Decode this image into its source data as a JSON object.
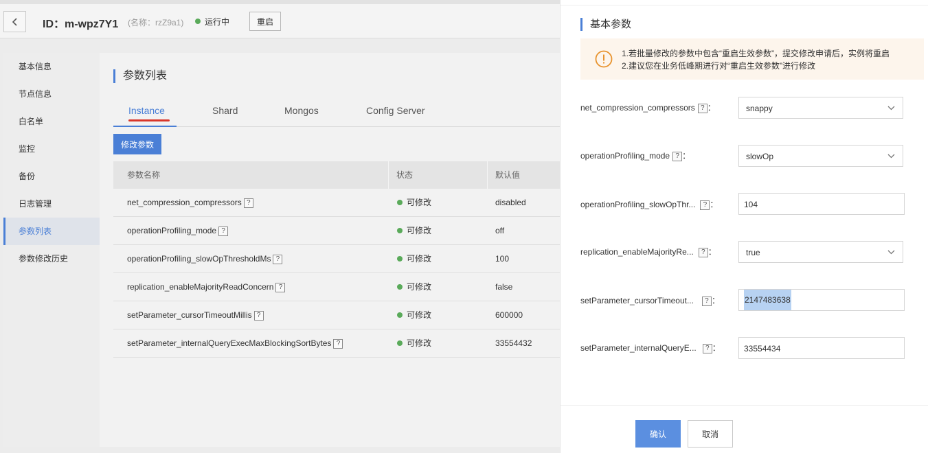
{
  "header": {
    "instance_id": "ID：m-wpz7Y1",
    "instance_name": "(名称：rzZ9a1)",
    "status": "运行中",
    "restart_label": "重启"
  },
  "sidebar": {
    "items": [
      {
        "label": "基本信息"
      },
      {
        "label": "节点信息"
      },
      {
        "label": "白名单"
      },
      {
        "label": "监控"
      },
      {
        "label": "备份"
      },
      {
        "label": "日志管理"
      },
      {
        "label": "参数列表"
      },
      {
        "label": "参数修改历史"
      }
    ],
    "active_index": 6
  },
  "main": {
    "section_title": "参数列表",
    "tabs": [
      {
        "label": "Instance"
      },
      {
        "label": "Shard"
      },
      {
        "label": "Mongos"
      },
      {
        "label": "Config Server"
      }
    ],
    "active_tab": 0,
    "modify_button": "修改参数",
    "table": {
      "headers": [
        "参数名称",
        "状态",
        "默认值"
      ],
      "rows": [
        {
          "name": "net_compression_compressors",
          "status": "可修改",
          "default": "disabled"
        },
        {
          "name": "operationProfiling_mode",
          "status": "可修改",
          "default": "off"
        },
        {
          "name": "operationProfiling_slowOpThresholdMs",
          "status": "可修改",
          "default": "100"
        },
        {
          "name": "replication_enableMajorityReadConcern",
          "status": "可修改",
          "default": "false"
        },
        {
          "name": "setParameter_cursorTimeoutMillis",
          "status": "可修改",
          "default": "600000"
        },
        {
          "name": "setParameter_internalQueryExecMaxBlockingSortBytes",
          "status": "可修改",
          "default": "33554432"
        }
      ]
    }
  },
  "drawer": {
    "title": "基本参数",
    "notice": {
      "line1": "1.若批量修改的参数中包含“重启生效参数”，提交修改申请后，实例将重启",
      "line2": "2.建议您在业务低峰期进行对“重启生效参数”进行修改"
    },
    "help_mark": "?",
    "colon": "：",
    "fields": [
      {
        "label": "net_compression_compressors",
        "type": "select",
        "value": "snappy"
      },
      {
        "label": "operationProfiling_mode",
        "type": "select",
        "value": "slowOp"
      },
      {
        "label": "operationProfiling_slowOpThr...",
        "type": "input",
        "value": "104"
      },
      {
        "label": "replication_enableMajorityRe...",
        "type": "select",
        "value": "true"
      },
      {
        "label": "setParameter_cursorTimeout...",
        "type": "input",
        "value": "2147483638",
        "selected": true
      },
      {
        "label": "setParameter_internalQueryE...",
        "type": "input",
        "value": "33554434"
      }
    ],
    "confirm_label": "确认",
    "cancel_label": "取消"
  },
  "colors": {
    "accent": "#4a7fd6",
    "tab_underline": "#d9362b",
    "status_green": "#5aaa5a",
    "notice_bg": "#fdf5ec",
    "notice_icon": "#e8932e"
  }
}
